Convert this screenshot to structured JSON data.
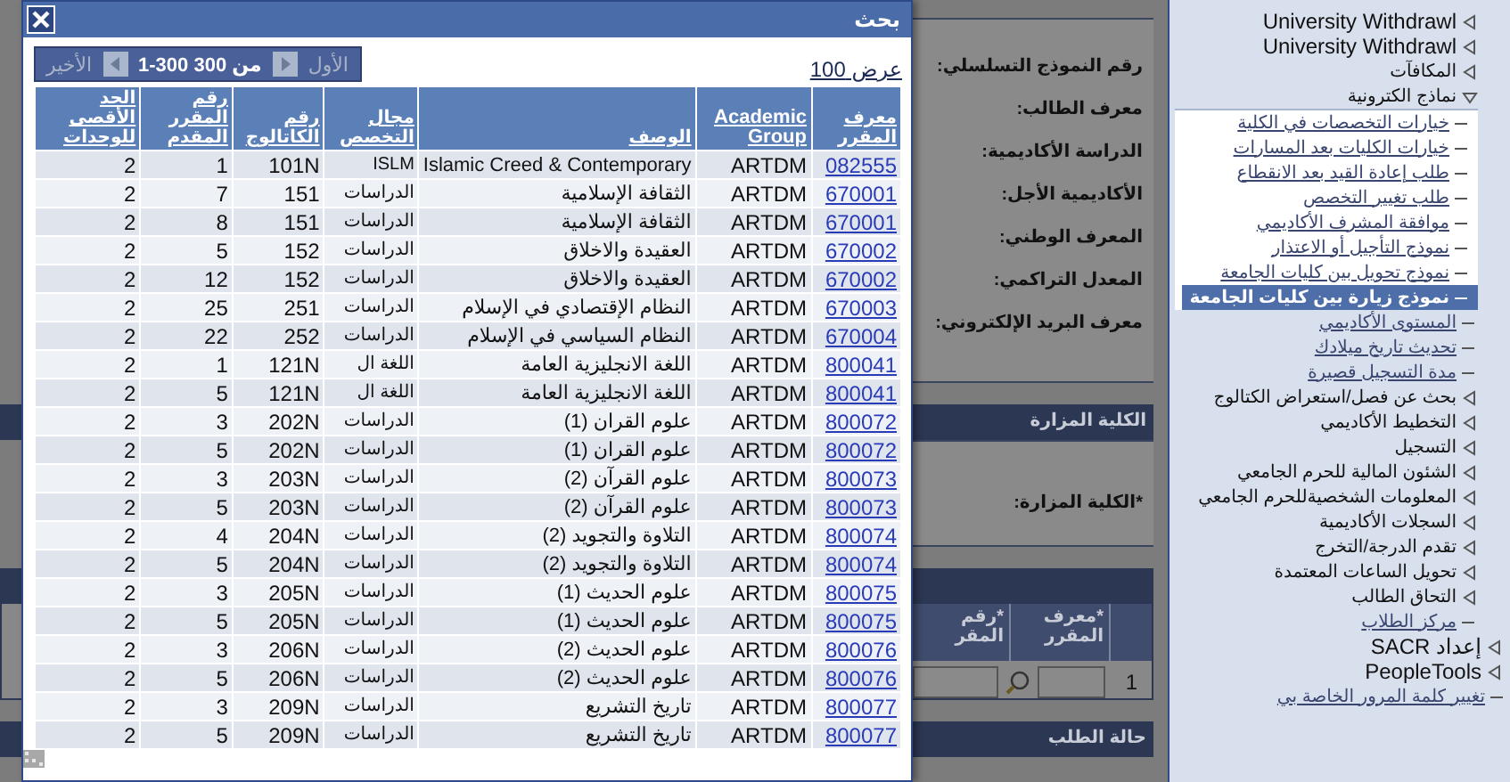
{
  "form": {
    "fields": [
      "رقم النموذج التسلسلي:",
      "معرف الطالب:",
      "الدراسة الأكاديمية:",
      "الأكاديمية الأجل:",
      "المعرف الوطني:",
      "المعدل التراكمي:",
      "معرف البريد الإلكتروني:"
    ],
    "visited_college": {
      "title": "الكلية المزارة",
      "field": "*الكلية المزارة:"
    },
    "courses_grid": {
      "columns": [
        "*معرف المقرر",
        "*رقم المقر"
      ],
      "row_number": "1"
    },
    "status_section": {
      "title": "حالة الطلب"
    }
  },
  "search_dialog": {
    "title": "بحث",
    "pager": {
      "first": {
        "label": "الأول",
        "disabled": true
      },
      "range": "1-300 من 300",
      "last": {
        "label": "الأخير",
        "disabled": true
      }
    },
    "view_link": "عرض 100",
    "table": {
      "columns": [
        "معرف المقرر",
        "Academic Group",
        "الوصف",
        "مجال التخصص",
        "رقم الكاتالوج",
        "رقم المقرر المقدم",
        "الحد الأقصى للوحدات"
      ],
      "rows": [
        [
          "082555",
          "ARTDM",
          "Islamic Creed & Contemporary",
          "ISLM",
          "101N",
          "1",
          "2"
        ],
        [
          "670001",
          "ARTDM",
          "الثقافة الإسلامية",
          "الدراسات",
          "151",
          "7",
          "2"
        ],
        [
          "670001",
          "ARTDM",
          "الثقافة الإسلامية",
          "الدراسات",
          "151",
          "8",
          "2"
        ],
        [
          "670002",
          "ARTDM",
          "العقيدة والاخلاق",
          "الدراسات",
          "152",
          "5",
          "2"
        ],
        [
          "670002",
          "ARTDM",
          "العقيدة والاخلاق",
          "الدراسات",
          "152",
          "12",
          "2"
        ],
        [
          "670003",
          "ARTDM",
          "النظام الإقتصادي في الإسلام",
          "الدراسات",
          "251",
          "25",
          "2"
        ],
        [
          "670004",
          "ARTDM",
          "النظام السياسي في الإسلام",
          "الدراسات",
          "252",
          "22",
          "2"
        ],
        [
          "800041",
          "ARTDM",
          "اللغة الانجليزية العامة",
          "اللغة ال",
          "121N",
          "1",
          "2"
        ],
        [
          "800041",
          "ARTDM",
          "اللغة الانجليزية العامة",
          "اللغة ال",
          "121N",
          "5",
          "2"
        ],
        [
          "800072",
          "ARTDM",
          "علوم القران (1)",
          "الدراسات",
          "202N",
          "3",
          "2"
        ],
        [
          "800072",
          "ARTDM",
          "علوم القران (1)",
          "الدراسات",
          "202N",
          "5",
          "2"
        ],
        [
          "800073",
          "ARTDM",
          "علوم القرآن (2)",
          "الدراسات",
          "203N",
          "3",
          "2"
        ],
        [
          "800073",
          "ARTDM",
          "علوم القرآن (2)",
          "الدراسات",
          "203N",
          "5",
          "2"
        ],
        [
          "800074",
          "ARTDM",
          "التلاوة والتجويد (2)",
          "الدراسات",
          "204N",
          "4",
          "2"
        ],
        [
          "800074",
          "ARTDM",
          "التلاوة والتجويد (2)",
          "الدراسات",
          "204N",
          "5",
          "2"
        ],
        [
          "800075",
          "ARTDM",
          "علوم الحديث (1)",
          "الدراسات",
          "205N",
          "3",
          "2"
        ],
        [
          "800075",
          "ARTDM",
          "علوم الحديث (1)",
          "الدراسات",
          "205N",
          "5",
          "2"
        ],
        [
          "800076",
          "ARTDM",
          "علوم الحديث (2)",
          "الدراسات",
          "206N",
          "3",
          "2"
        ],
        [
          "800076",
          "ARTDM",
          "علوم الحديث (2)",
          "الدراسات",
          "206N",
          "5",
          "2"
        ],
        [
          "800077",
          "ARTDM",
          "تاريخ التشريع",
          "الدراسات",
          "209N",
          "3",
          "2"
        ],
        [
          "800077",
          "ARTDM",
          "تاريخ التشريع",
          "الدراسات",
          "209N",
          "5",
          "2"
        ]
      ]
    }
  },
  "sidebar": {
    "nested_items": [
      {
        "kind": "folder",
        "label": "University Withdrawl",
        "expanded": false
      },
      {
        "kind": "folder",
        "label": "University Withdrawl",
        "expanded": false
      },
      {
        "kind": "folder",
        "label": "المكافآت",
        "expanded": false
      },
      {
        "kind": "folder",
        "label": "نماذج الكترونية",
        "expanded": true,
        "children": [
          {
            "kind": "link",
            "label": "خيارات التخصصات في الكلية",
            "selected": false
          },
          {
            "kind": "link",
            "label": "خيارات الكليات بعد المسارات",
            "selected": false
          },
          {
            "kind": "link",
            "label": "طلب إعادة القيد بعد الانقطاع",
            "selected": false
          },
          {
            "kind": "link",
            "label": "طلب تغيير التخصص",
            "selected": false
          },
          {
            "kind": "link",
            "label": "موافقة المشرف الأكاديمي",
            "selected": false
          },
          {
            "kind": "link",
            "label": "نموذج التأجيل أو الاعتذار",
            "selected": false
          },
          {
            "kind": "link",
            "label": "نموذج تحويل بين كليات الجامعة",
            "selected": false
          },
          {
            "kind": "link",
            "label": "نموذج زيارة بين كليات الجامعة",
            "selected": true
          }
        ]
      },
      {
        "kind": "link",
        "label": "المستوى الأكاديمي",
        "selected": false
      },
      {
        "kind": "link",
        "label": "تحديث تاريخ ميلادك",
        "selected": false
      },
      {
        "kind": "link",
        "label": "مدة التسجيل قصيرة",
        "selected": false
      },
      {
        "kind": "folder",
        "label": "بحث عن فصل/استعراض الكتالوج",
        "expanded": false
      },
      {
        "kind": "folder",
        "label": "التخطيط الأكاديمي",
        "expanded": false
      },
      {
        "kind": "folder",
        "label": "التسجيل",
        "expanded": false
      },
      {
        "kind": "folder",
        "label": "الشئون المالية للحرم الجامعي",
        "expanded": false
      },
      {
        "kind": "folder",
        "label": "المعلومات الشخصيةللحرم الجامعي",
        "expanded": false
      },
      {
        "kind": "folder",
        "label": "السجلات الأكاديمية",
        "expanded": false
      },
      {
        "kind": "folder",
        "label": "تقدم الدرجة/التخرج",
        "expanded": false
      },
      {
        "kind": "folder",
        "label": "تحويل الساعات المعتمدة",
        "expanded": false
      },
      {
        "kind": "folder",
        "label": "التحاق الطالب",
        "expanded": false
      },
      {
        "kind": "link",
        "label": "مركز الطلاب",
        "selected": false
      }
    ],
    "items": [
      {
        "kind": "folder",
        "label": "إعداد SACR",
        "expanded": false
      },
      {
        "kind": "folder",
        "label": "PeopleTools",
        "expanded": false
      },
      {
        "kind": "link",
        "label": "تغيير كلمة المرور الخاصة بي",
        "selected": false
      }
    ]
  }
}
